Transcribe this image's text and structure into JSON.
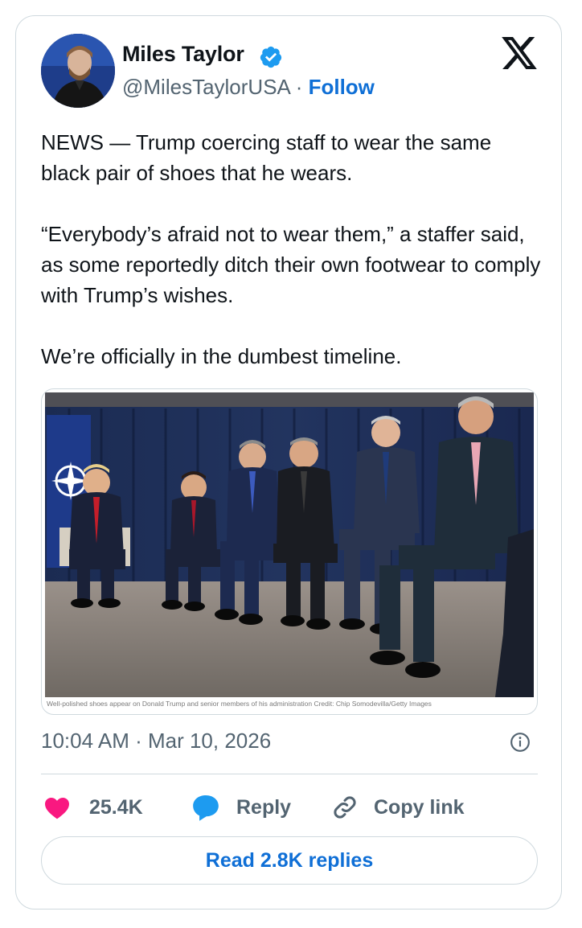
{
  "author": {
    "name": "Miles Taylor",
    "handle": "@MilesTaylorUSA",
    "separator": "·",
    "follow_label": "Follow",
    "verified": true
  },
  "platform_logo": "x-logo-icon",
  "tweet": {
    "paragraphs": [
      "NEWS — Trump coercing staff to wear the same black pair of shoes that he wears.",
      "“Everybody’s afraid not to wear them,” a staffer said, as some reportedly ditch their own footwear to comply with Trump’s wishes.",
      "We’re officially in the dumbest timeline."
    ]
  },
  "media": {
    "caption": "Well-polished shoes appear on Donald Trump and senior members of his administration  Credit: Chip Somodevilla/Getty Images"
  },
  "meta": {
    "timestamp": "10:04 AM · Mar 10, 2026"
  },
  "actions": {
    "likes": "25.4K",
    "reply_label": "Reply",
    "copy_label": "Copy link"
  },
  "read_replies_label": "Read 2.8K replies",
  "colors": {
    "link_blue": "#0f6fd6",
    "verified_blue": "#1d9bf0",
    "heart_pink": "#f91880",
    "border": "#cfd9de",
    "secondary_text": "#536471"
  }
}
